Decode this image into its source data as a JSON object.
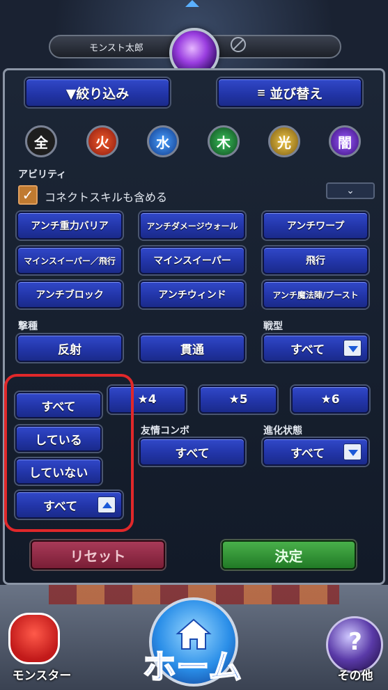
{
  "header": {
    "player_name": "モンスト太郎"
  },
  "toolbar": {
    "filter_label": "▼絞り込み",
    "sort_label": "並び替え"
  },
  "elements": [
    {
      "name": "all",
      "glyph": "全",
      "color": "#2a2a2a"
    },
    {
      "name": "fire",
      "glyph": "火",
      "color": "#c0281a"
    },
    {
      "name": "water",
      "glyph": "水",
      "color": "#1a5ad8"
    },
    {
      "name": "wood",
      "glyph": "木",
      "color": "#1a8a3a"
    },
    {
      "name": "light",
      "glyph": "光",
      "color": "#c8a01a"
    },
    {
      "name": "dark",
      "glyph": "闇",
      "color": "#6a2ab8"
    }
  ],
  "ability": {
    "section_label": "アビリティ",
    "connect_skill_label": "コネクトスキルも含める",
    "connect_skill_checked": true,
    "collapse_icon": "chevron-down-icon",
    "buttons": [
      "アンチ重力バリア",
      "アンチダメージウォール",
      "アンチワープ",
      "マインスイーパー／飛行",
      "マインスイーパー",
      "飛行",
      "アンチブロック",
      "アンチウィンド",
      "アンチ魔法陣/ブースト"
    ]
  },
  "attack_type": {
    "label": "撃種",
    "buttons": [
      "反射",
      "貫通"
    ]
  },
  "battle_type": {
    "label": "戦型",
    "value": "すべて"
  },
  "rarity": {
    "buttons": [
      "★4",
      "★5",
      "★6"
    ]
  },
  "friendship": {
    "label": "友情コンボ",
    "value": "すべて"
  },
  "evolution": {
    "label": "進化状態",
    "value": "すべて"
  },
  "dropdown": {
    "options": [
      "すべて",
      "している",
      "していない"
    ],
    "selected": "すべて"
  },
  "actions": {
    "reset_label": "リセット",
    "confirm_label": "決定"
  },
  "nav": {
    "monster_label": "モンスター",
    "home_label": "ホーム",
    "other_label": "その他"
  },
  "colors": {
    "accent_blue": "#2235a8",
    "highlight_red": "#e0282a",
    "confirm_green": "#3a9a3c",
    "reset_red": "#8a2a44"
  }
}
